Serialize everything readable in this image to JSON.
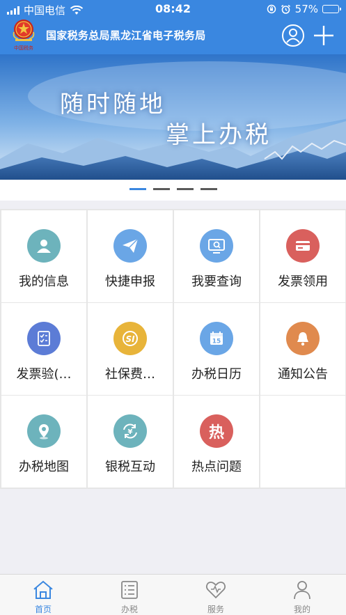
{
  "status_bar": {
    "carrier": "中国电信",
    "time": "08:42",
    "battery": "57%",
    "battery_level": 0.57
  },
  "header": {
    "title": "国家税务总局黑龙江省电子税务局",
    "logo_text": "中国税务"
  },
  "banner": {
    "line1": "随时随地",
    "line2": "掌上办税",
    "pages": 4,
    "active_page": 0
  },
  "menu": [
    {
      "label": "我的信息",
      "icon": "person-icon",
      "color": "#6db3bc"
    },
    {
      "label": "快捷申报",
      "icon": "paper-plane-icon",
      "color": "#6aa6e6"
    },
    {
      "label": "我要查询",
      "icon": "search-screen-icon",
      "color": "#6aa6e6"
    },
    {
      "label": "发票领用",
      "icon": "invoice-card-icon",
      "color": "#d9605d"
    },
    {
      "label": "发票验(…",
      "icon": "checklist-icon",
      "color": "#5c7cd6"
    },
    {
      "label": "社保费…",
      "icon": "social-security-icon",
      "color": "#e8b43a"
    },
    {
      "label": "办税日历",
      "icon": "calendar-icon",
      "color": "#6aa6e6",
      "calendar_day": "15"
    },
    {
      "label": "通知公告",
      "icon": "bell-icon",
      "color": "#e08a4e"
    },
    {
      "label": "办税地图",
      "icon": "map-pin-icon",
      "color": "#6db3bc"
    },
    {
      "label": "银税互动",
      "icon": "yen-exchange-icon",
      "color": "#6db3bc",
      "symbol": "¥"
    },
    {
      "label": "热点问题",
      "icon": "hot-topic-icon",
      "color": "#d9605d",
      "symbol": "热"
    }
  ],
  "tabs": [
    {
      "label": "首页",
      "icon": "home-icon",
      "active": true
    },
    {
      "label": "办税",
      "icon": "list-icon",
      "active": false
    },
    {
      "label": "服务",
      "icon": "heart-icon",
      "active": false
    },
    {
      "label": "我的",
      "icon": "user-icon",
      "active": false
    }
  ],
  "colors": {
    "brand": "#3a87e0",
    "background": "#efeff4",
    "inactive": "#888888"
  }
}
